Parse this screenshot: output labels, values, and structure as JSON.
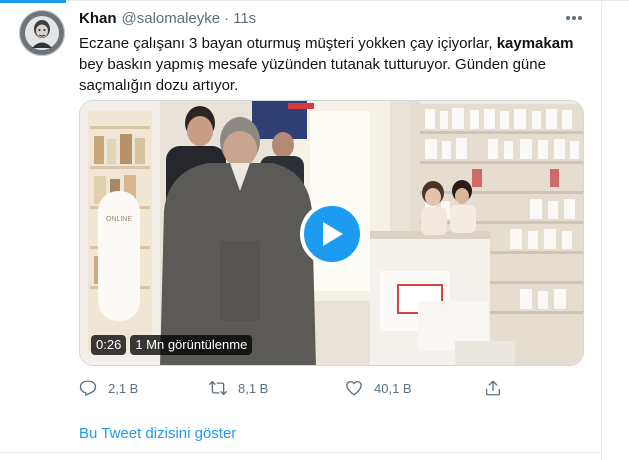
{
  "tweet": {
    "name": "Khan",
    "handle": "@salomaleyke",
    "separator": "·",
    "time": "11s",
    "text_before": "Eczane çalışanı 3 bayan oturmuş müşteri yokken çay içiyorlar, ",
    "text_bold": "kaymakam",
    "text_after": " bey baskın yapmış mesafe yüzünden tutanak tutturuyor. Günden güne saçmalığın dozu artıyor."
  },
  "video": {
    "duration": "0:26",
    "views": "1 Mn görüntülenme",
    "poster_sign": "ONLINE"
  },
  "actions": {
    "reply_count": "2,1 B",
    "retweet_count": "8,1 B",
    "like_count": "40,1 B"
  },
  "thread_link": "Bu Tweet dizisini göster",
  "colors": {
    "accent": "#1d9bf0",
    "secondary_text": "#5b7083",
    "primary_text": "#0f1419"
  },
  "icons": [
    "more-icon",
    "reply-icon",
    "retweet-icon",
    "like-icon",
    "share-icon",
    "play-icon"
  ]
}
